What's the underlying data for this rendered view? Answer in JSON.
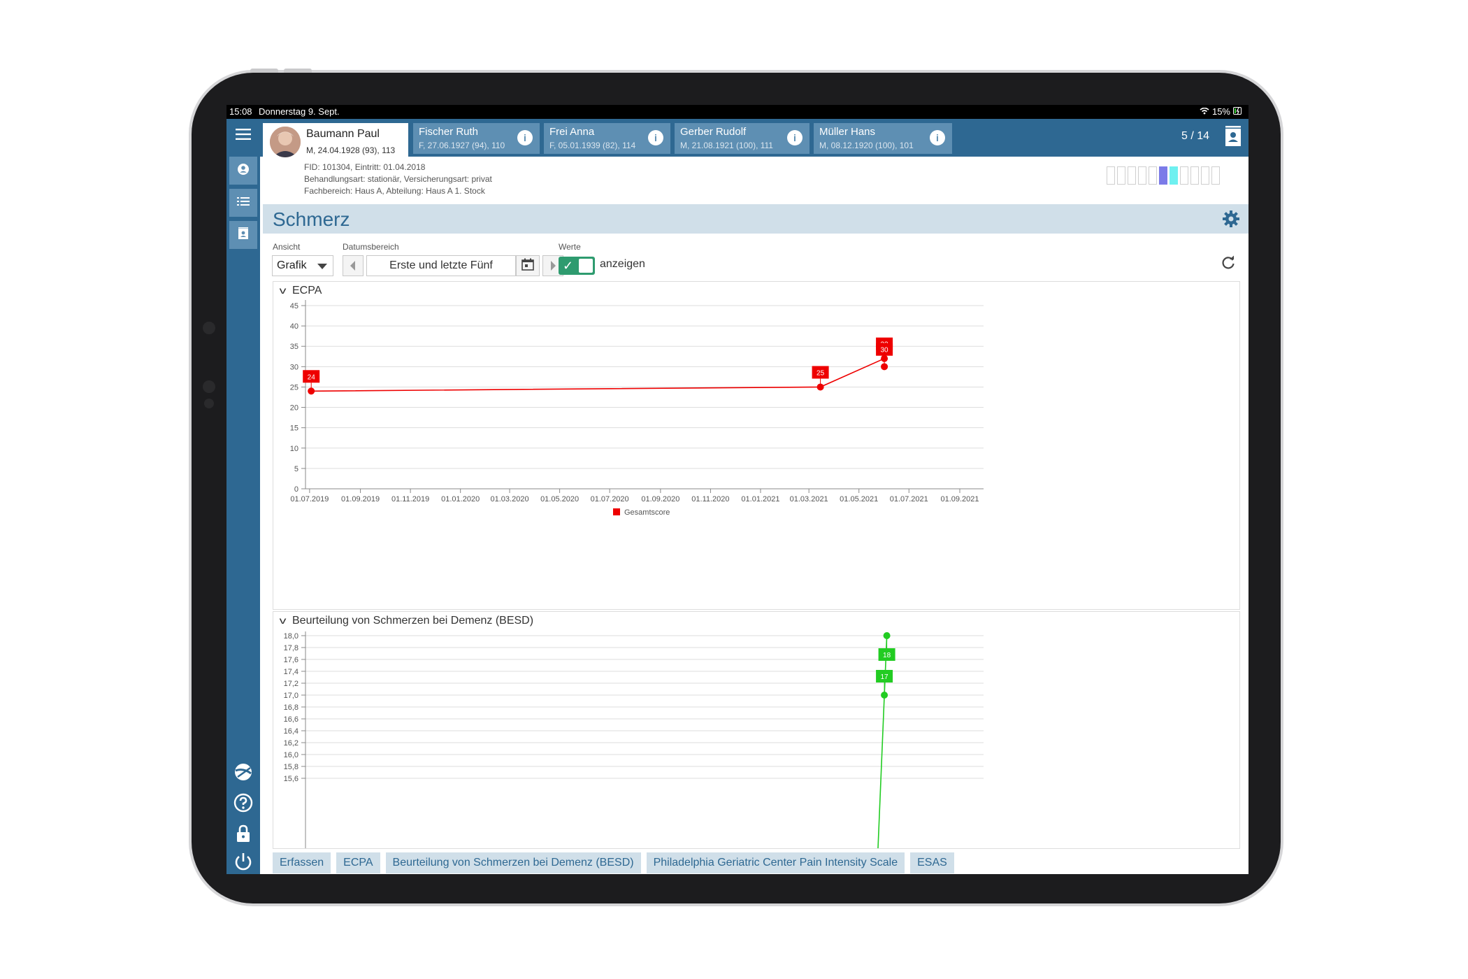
{
  "status": {
    "time": "15:08",
    "date": "Donnerstag 9. Sept.",
    "battery": "15%"
  },
  "patient_tabs": [
    {
      "name": "Baumann Paul",
      "meta": "M, 24.04.1928 (93), 113",
      "active": true
    },
    {
      "name": "Fischer Ruth",
      "meta": "F, 27.06.1927 (94), 110",
      "active": false
    },
    {
      "name": "Frei Anna",
      "meta": "F, 05.01.1939 (82), 114",
      "active": false
    },
    {
      "name": "Gerber Rudolf",
      "meta": "M, 21.08.1921 (100), 111",
      "active": false
    },
    {
      "name": "Müller Hans",
      "meta": "M, 08.12.1920 (100), 101",
      "active": false
    }
  ],
  "pager": "5 / 14",
  "patient_info": {
    "line1": "FID: 101304, Eintritt: 01.04.2018",
    "line2": "Behandlungsart: stationär, Versicherungsart: privat",
    "line3": "Fachbereich: Haus A, Abteilung: Haus A 1. Stock"
  },
  "page_title": "Schmerz",
  "controls": {
    "view_label": "Ansicht",
    "view_value": "Grafik",
    "date_label": "Datumsbereich",
    "date_value": "Erste und letzte Fünf",
    "values_label": "Werte",
    "values_toggle_text": "anzeigen"
  },
  "bottom_tabs": [
    "Erfassen",
    "ECPA",
    "Beurteilung von Schmerzen bei Demenz (BESD)",
    "Philadelphia Geriatric Center Pain Intensity Scale",
    "ESAS"
  ],
  "colors": {
    "primary": "#2e6892",
    "ecpa": "#ee0000",
    "besd": "#22cc22"
  },
  "chart_data": [
    {
      "type": "line",
      "title": "ECPA",
      "series": [
        {
          "name": "Gesamtscore",
          "color": "#ee0000",
          "points": [
            {
              "x": "2019-07-03",
              "y": 24
            },
            {
              "x": "2021-03-15",
              "y": 25
            },
            {
              "x": "2021-06-01",
              "y": 32
            },
            {
              "x": "2021-06-01",
              "y": 30
            }
          ]
        }
      ],
      "ylim": [
        0,
        45
      ],
      "yticks": [
        "0",
        "5",
        "10",
        "15",
        "20",
        "25",
        "30",
        "35",
        "40",
        "45"
      ],
      "xlim": [
        "2019-06-26",
        "2021-09-30"
      ],
      "xticks": [
        {
          "date": "2019-07-01",
          "label": "01.07.2019"
        },
        {
          "date": "2019-09-01",
          "label": "01.09.2019"
        },
        {
          "date": "2019-11-01",
          "label": "01.11.2019"
        },
        {
          "date": "2020-01-01",
          "label": "01.01.2020"
        },
        {
          "date": "2020-03-01",
          "label": "01.03.2020"
        },
        {
          "date": "2020-05-01",
          "label": "01.05.2020"
        },
        {
          "date": "2020-07-01",
          "label": "01.07.2020"
        },
        {
          "date": "2020-09-01",
          "label": "01.09.2020"
        },
        {
          "date": "2020-11-01",
          "label": "01.11.2020"
        },
        {
          "date": "2021-01-01",
          "label": "01.01.2021"
        },
        {
          "date": "2021-03-01",
          "label": "01.03.2021"
        },
        {
          "date": "2021-05-01",
          "label": "01.05.2021"
        },
        {
          "date": "2021-07-01",
          "label": "01.07.2021"
        },
        {
          "date": "2021-09-01",
          "label": "01.09.2021"
        }
      ],
      "legend": "bottom"
    },
    {
      "type": "line",
      "title": "Beurteilung von Schmerzen bei Demenz (BESD)",
      "series": [
        {
          "name": "",
          "color": "#22cc22",
          "points": [
            {
              "x": "2021-06-01",
              "y": 17
            },
            {
              "x": "2021-06-04",
              "y": 18
            }
          ]
        }
      ],
      "ylim": [
        15.6,
        18.0
      ],
      "yticks": [
        "15,6",
        "15,8",
        "16,0",
        "16,2",
        "16,4",
        "16,6",
        "16,8",
        "17,0",
        "17,2",
        "17,4",
        "17,6",
        "17,8",
        "18,0"
      ]
    }
  ]
}
